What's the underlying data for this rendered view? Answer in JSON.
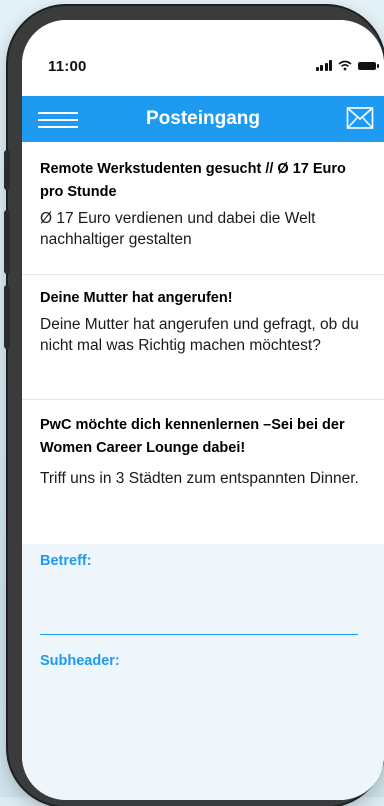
{
  "status_bar": {
    "time": "11:00",
    "signal_icon": "cellular-signal-icon",
    "wifi_icon": "wifi-icon",
    "battery_icon": "battery-icon"
  },
  "app_bar": {
    "title": "Posteingang",
    "menu_icon": "hamburger-menu-icon",
    "compose_icon": "envelope-icon",
    "color": "#1e9bf0"
  },
  "messages": [
    {
      "subject": "Remote Werkstudenten gesucht // Ø 17 Euro pro Stunde",
      "preview": "Ø 17 Euro verdienen und dabei die Welt    nachhaltiger gestalten"
    },
    {
      "subject": "Deine Mutter hat angerufen!",
      "preview": "Deine Mutter hat angerufen und gefragt, ob du    nicht mal was Richtig machen möchtest?"
    },
    {
      "subject": "PwC möchte dich kennenlernen –Sei bei der Women Career Lounge dabei!",
      "preview": "Triff uns in 3 Städten zum entspannten Dinner."
    }
  ],
  "compose": {
    "subject_label": "Betreff:",
    "subject_value": "",
    "subheader_label": "Subheader:",
    "background": "#eef6fb"
  }
}
